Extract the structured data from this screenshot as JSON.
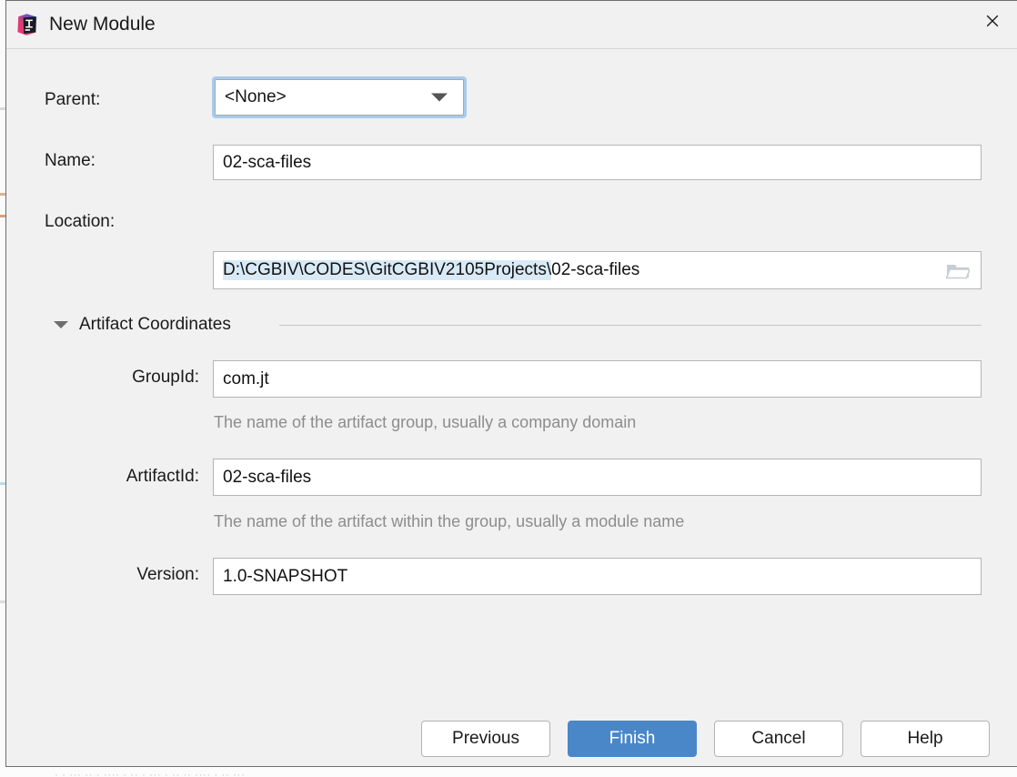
{
  "window": {
    "title": "New Module",
    "app_icon": "intellij-idea-logo",
    "close_icon": "close-icon"
  },
  "form": {
    "parent": {
      "label": "Parent:",
      "value": "<None>",
      "dropdown_icon": "chevron-down-icon"
    },
    "name": {
      "label": "Name:",
      "value": "02-sca-files"
    },
    "location": {
      "label": "Location:",
      "value": "D:\\CGBIV\\CODES\\GitCGBIV2105Projects\\02-sca-files",
      "value_selected": "D:\\CGBIV\\CODES\\GitCGBIV2105Projects\\",
      "value_rest": "02-sca-files",
      "browse_icon": "folder-icon"
    },
    "artifact_section": {
      "title": "Artifact Coordinates",
      "expanded": true,
      "toggle_icon": "chevron-down-icon",
      "group_id": {
        "label": "GroupId:",
        "value": "com.jt",
        "hint": "The name of the artifact group, usually a company domain"
      },
      "artifact_id": {
        "label": "ArtifactId:",
        "value": "02-sca-files",
        "hint": "The name of the artifact within the group, usually a module name"
      },
      "version": {
        "label": "Version:",
        "value": "1.0-SNAPSHOT"
      }
    }
  },
  "footer": {
    "previous_label": "Previous",
    "finish_label": "Finish",
    "cancel_label": "Cancel",
    "help_label": "Help"
  },
  "colors": {
    "accent": "#4a87c8",
    "focus_ring": "#a8cbec",
    "dialog_bg": "#f1f1f1",
    "field_bg": "#ffffff",
    "hint_text": "#8d8d8d",
    "selection": "#d9eaf7"
  }
}
